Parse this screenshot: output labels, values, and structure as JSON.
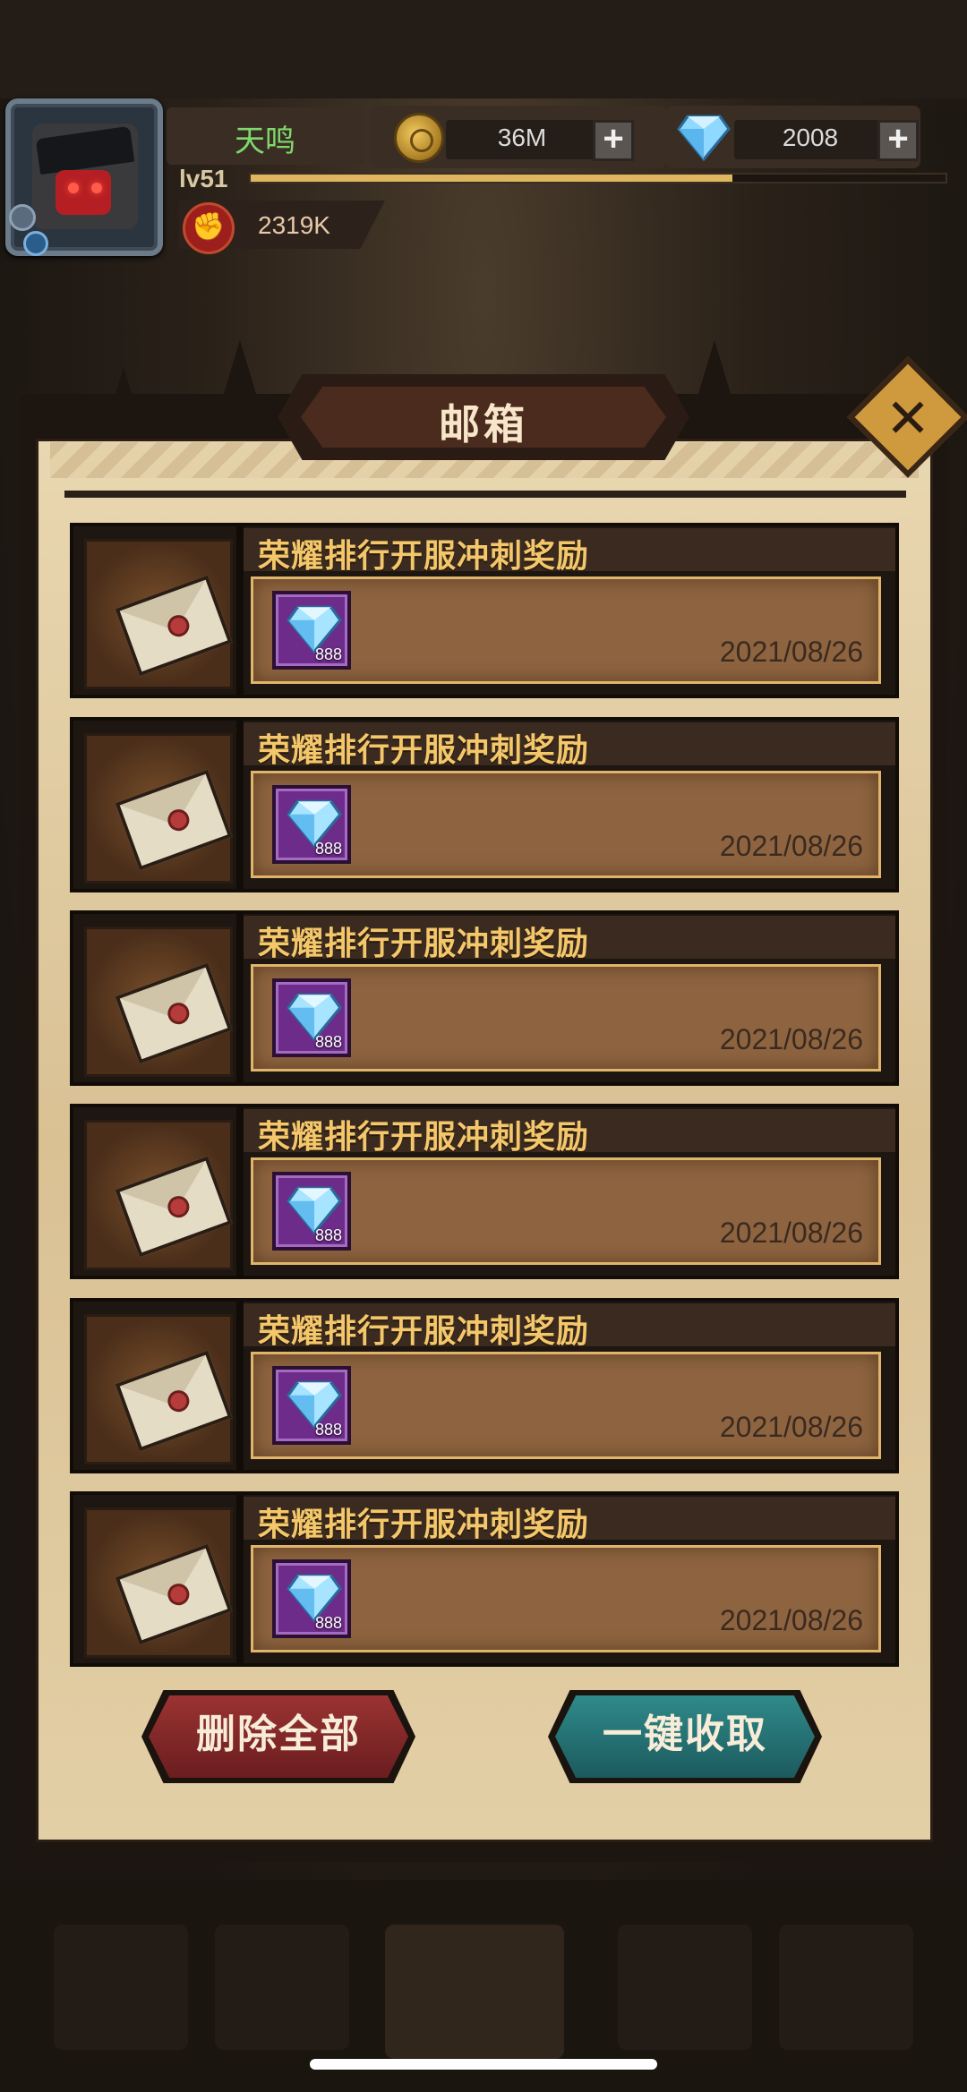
{
  "player": {
    "name": "天鸣",
    "level": "lv51",
    "power": "2319K",
    "xp_progress": 0.69
  },
  "resources": {
    "gold": "36M",
    "diamonds": "2008"
  },
  "mailbox": {
    "title": "邮箱",
    "items": [
      {
        "subject": "荣耀排行开服冲刺奖励",
        "reward_count": "888",
        "date": "2021/08/26"
      },
      {
        "subject": "荣耀排行开服冲刺奖励",
        "reward_count": "888",
        "date": "2021/08/26"
      },
      {
        "subject": "荣耀排行开服冲刺奖励",
        "reward_count": "888",
        "date": "2021/08/26"
      },
      {
        "subject": "荣耀排行开服冲刺奖励",
        "reward_count": "888",
        "date": "2021/08/26"
      },
      {
        "subject": "荣耀排行开服冲刺奖励",
        "reward_count": "888",
        "date": "2021/08/26"
      },
      {
        "subject": "荣耀排行开服冲刺奖励",
        "reward_count": "888",
        "date": "2021/08/26"
      }
    ],
    "delete_all_label": "删除全部",
    "collect_all_label": "一键收取"
  },
  "colors": {
    "accent_gold": "#f3c76a",
    "delete_red": "#9b3332",
    "collect_teal": "#2f8a8a",
    "reward_purple": "#6d2b8a"
  },
  "icons": {
    "close": "close-icon",
    "mail": "envelope-icon",
    "reward": "diamond-icon",
    "gold": "coin-icon",
    "power": "fist-icon"
  }
}
